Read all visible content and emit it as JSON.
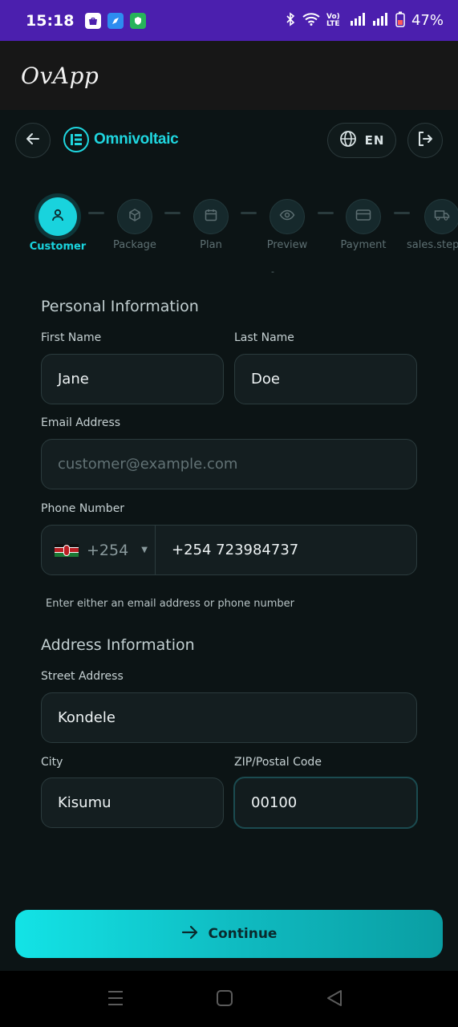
{
  "status_bar": {
    "time": "15:18",
    "network_text": "Vo) LTE",
    "battery": "47%"
  },
  "app_bar": {
    "title": "OvApp"
  },
  "header": {
    "brand_name": "Omnivoltaic",
    "language": "EN",
    "icons": [
      "arrow-left-icon",
      "brand-logo-icon",
      "globe-icon",
      "logout-icon"
    ]
  },
  "stepper": {
    "steps": [
      {
        "label": "Customer",
        "icon": "user-icon",
        "active": true
      },
      {
        "label": "Package",
        "icon": "box-icon",
        "active": false
      },
      {
        "label": "Plan",
        "icon": "calendar-icon",
        "active": false
      },
      {
        "label": "Preview",
        "icon": "eye-icon",
        "active": false
      },
      {
        "label": "Payment",
        "icon": "card-icon",
        "active": false
      },
      {
        "label": "sales.step",
        "icon": "truck-icon",
        "active": false
      }
    ],
    "dash": "-"
  },
  "personal": {
    "title": "Personal Information",
    "first_name_label": "First Name",
    "first_name": "Jane",
    "last_name_label": "Last Name",
    "last_name": "Doe",
    "email_label": "Email Address",
    "email_placeholder": "customer@example.com",
    "phone_label": "Phone Number",
    "dial_code": "+254",
    "phone_value": "+254 723984737",
    "hint": "Enter either an email address or phone number"
  },
  "address": {
    "title": "Address Information",
    "street_label": "Street Address",
    "street": "Kondele",
    "city_label": "City",
    "city": "Kisumu",
    "zip_label": "ZIP/Postal Code",
    "zip": "00100"
  },
  "actions": {
    "continue_label": "Continue"
  },
  "colors": {
    "accent": "#19d3dd",
    "status_bar": "#4b1fae",
    "background": "#0c1415"
  }
}
